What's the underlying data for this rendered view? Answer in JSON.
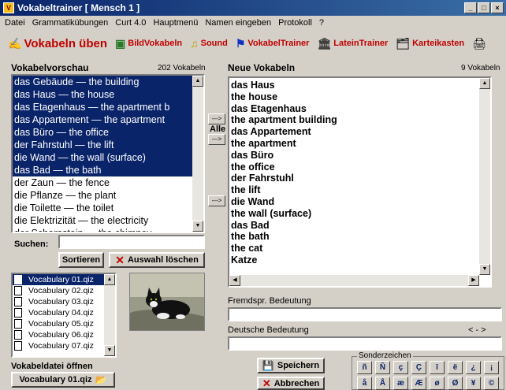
{
  "window": {
    "title": "Vokabeltrainer  [ Mensch 1 ]"
  },
  "menu": [
    "Datei",
    "Grammatikübungen",
    "Curt 4.0",
    "Hauptmenü",
    "Namen eingeben",
    "Protokoll",
    "?"
  ],
  "toolbar": [
    {
      "label": "Vokabeln üben",
      "icon": "click-icon",
      "big": true
    },
    {
      "label": "BildVokabeln",
      "icon": "picture-icon",
      "big": false
    },
    {
      "label": "Sound",
      "icon": "sound-icon",
      "big": false
    },
    {
      "label": "VokabelTrainer",
      "icon": "flags-icon",
      "big": false
    },
    {
      "label": "LateinTrainer",
      "icon": "temple-icon",
      "big": false
    },
    {
      "label": "Karteikasten",
      "icon": "cards-icon",
      "big": false
    }
  ],
  "preview": {
    "title": "Vokabelvorschau",
    "count": "202 Vokabeln",
    "items": [
      {
        "text": "das Gebäude — the building",
        "selected": true
      },
      {
        "text": "das Haus — the house",
        "selected": true
      },
      {
        "text": "das Etagenhaus — the apartment b",
        "selected": true
      },
      {
        "text": "das Appartement — the apartment",
        "selected": true
      },
      {
        "text": "das Büro — the office",
        "selected": true
      },
      {
        "text": "der Fahrstuhl — the lift",
        "selected": true
      },
      {
        "text": "die Wand — the wall (surface)",
        "selected": true
      },
      {
        "text": "das Bad — the bath",
        "selected": true
      },
      {
        "text": "der Zaun — the fence",
        "selected": false
      },
      {
        "text": "die Pflanze — the plant",
        "selected": false
      },
      {
        "text": "die Toilette — the toilet",
        "selected": false
      },
      {
        "text": "die Elektrizität — the electricity",
        "selected": false
      },
      {
        "text": "der Schornstein — the chimney",
        "selected": false
      }
    ]
  },
  "transfer": {
    "all_label": "Alle",
    "arrow": "--->"
  },
  "search": {
    "label": "Suchen:",
    "value": ""
  },
  "buttons": {
    "sort": "Sortieren",
    "clear": "Auswahl löschen",
    "save": "Speichern",
    "cancel": "Abbrechen"
  },
  "files": {
    "items": [
      {
        "name": "Vocabulary 01.qiz",
        "selected": true
      },
      {
        "name": "Vocabulary 02.qiz",
        "selected": false
      },
      {
        "name": "Vocabulary 03.qiz",
        "selected": false
      },
      {
        "name": "Vocabulary 04.qiz",
        "selected": false
      },
      {
        "name": "Vocabulary 05.qiz",
        "selected": false
      },
      {
        "name": "Vocabulary 06.qiz",
        "selected": false
      },
      {
        "name": "Vocabulary 07.qiz",
        "selected": false
      }
    ],
    "open_label": "Vokabeldatei öffnen",
    "current_file": "Vocabulary 01.qiz"
  },
  "new_vocab": {
    "title": "Neue Vokabeln",
    "count": "9 Vokabeln",
    "lines": [
      "das Haus",
      "the house",
      "das Etagenhaus",
      "the apartment building",
      "das Appartement",
      "the apartment",
      "das Büro",
      "the office",
      "der Fahrstuhl",
      "the lift",
      "die Wand",
      "the wall (surface)",
      "das Bad",
      "the bath",
      "the cat",
      "Katze"
    ]
  },
  "fields": {
    "foreign_label": "Fremdspr. Bedeutung",
    "foreign_value": "",
    "german_label": "Deutsche Bedeutung",
    "german_value": "",
    "arrows": "< - >"
  },
  "special_chars": {
    "title": "Sonderzeichen",
    "row1": [
      "ñ",
      "Ñ",
      "ç",
      "Ç",
      "ï",
      "ë",
      "¿",
      "¡"
    ],
    "row2": [
      "å",
      "Å",
      "æ",
      "Æ",
      "ø",
      "Ø",
      "¥",
      "©"
    ]
  }
}
